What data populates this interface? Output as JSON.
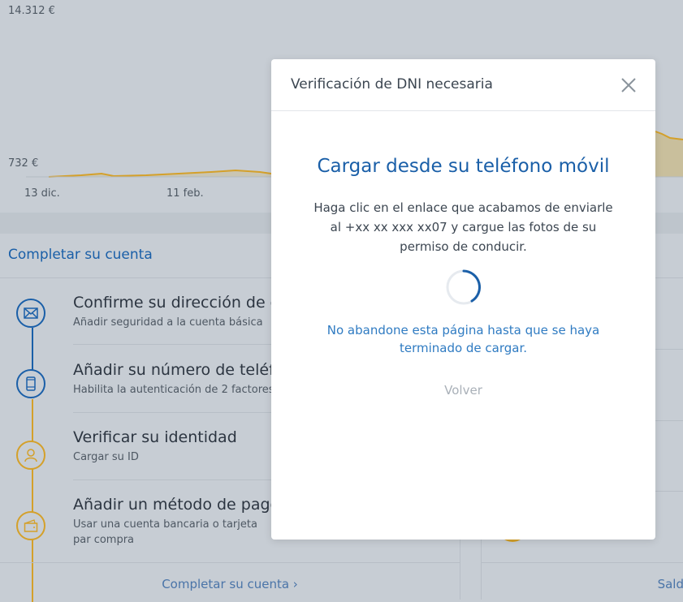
{
  "chart": {
    "y_max_label": "14.312 €",
    "y_min_label": "732 €",
    "x_labels": [
      "13 dic.",
      "11 feb."
    ],
    "line_color": "#d4a02a"
  },
  "account_card": {
    "title": "Completar su cuenta",
    "steps": [
      {
        "title": "Confirme su dirección de c",
        "desc": "Añadir seguridad a la cuenta básica",
        "icon": "envelope-icon",
        "color": "#1a5fa8"
      },
      {
        "title": "Añadir su número de teléfo",
        "desc": "Habilita la autenticación de 2 factores",
        "icon": "phone-icon",
        "color": "#1a5fa8"
      },
      {
        "title": "Verificar su identidad",
        "desc": "Cargar su ID",
        "icon": "user-icon",
        "color": "#d4a02a"
      },
      {
        "title": "Añadir un método de pago",
        "desc": "Usar una cuenta bancaria o tarjeta par compra",
        "icon": "wallet-icon",
        "color": "#d4a02a"
      }
    ],
    "footer_link": "Completar su cuenta ›"
  },
  "right_card": {
    "footer_link": "Sald"
  },
  "modal": {
    "title": "Verificación de DNI necesaria",
    "heading": "Cargar desde su teléfono móvil",
    "body": "Haga clic en el enlace que acabamos de enviarle al +xx xx xxx xx07 y cargue las fotos de su permiso de conducir.",
    "warning": "No abandone esta página hasta que se haya terminado de cargar.",
    "back_label": "Volver",
    "accent_color": "#1a5fa8"
  }
}
